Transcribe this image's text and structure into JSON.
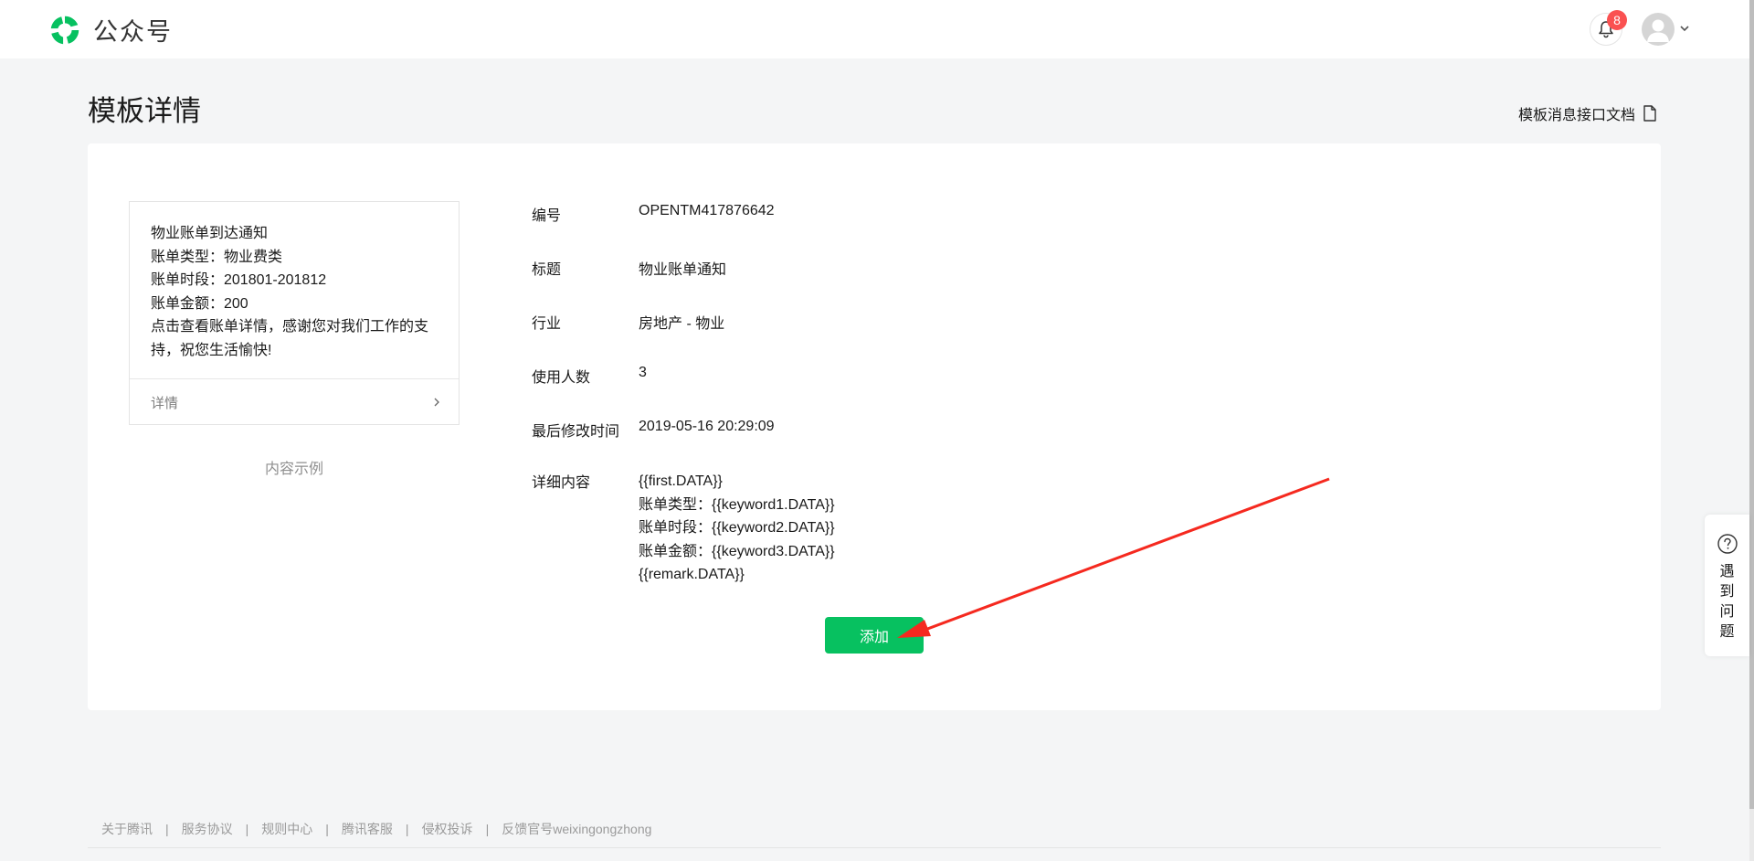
{
  "header": {
    "app_name": "公众号",
    "notification_count": "8",
    "colors": {
      "brand": "#07c160",
      "badge": "#fa5151"
    }
  },
  "page": {
    "title": "模板详情",
    "doc_link_label": "模板消息接口文档"
  },
  "preview": {
    "lines": [
      "物业账单到达通知",
      "账单类型：物业费类",
      "账单时段：201801-201812",
      "账单金额：200",
      "点击查看账单详情，感谢您对我们工作的支持，祝您生活愉快!"
    ],
    "details_label": "详情",
    "caption": "内容示例"
  },
  "details": {
    "id": {
      "label": "编号",
      "value": "OPENTM417876642"
    },
    "title": {
      "label": "标题",
      "value": "物业账单通知"
    },
    "industry": {
      "label": "行业",
      "value": "房地产 - 物业"
    },
    "usage": {
      "label": "使用人数",
      "value": "3"
    },
    "modified": {
      "label": "最后修改时间",
      "value": "2019-05-16 20:29:09"
    },
    "content": {
      "label": "详细内容",
      "lines": [
        "{{first.DATA}}",
        "账单类型：{{keyword1.DATA}}",
        "账单时段：{{keyword2.DATA}}",
        "账单金额：{{keyword3.DATA}}",
        "{{remark.DATA}}"
      ]
    }
  },
  "actions": {
    "add_label": "添加"
  },
  "help": {
    "label": "遇到问题"
  },
  "footer": {
    "links": [
      "关于腾讯",
      "服务协议",
      "规则中心",
      "腾讯客服",
      "侵权投诉",
      "反馈官号weixingongzhong"
    ],
    "separator": "|"
  },
  "annotation": {
    "arrow_color": "#f5291f"
  }
}
